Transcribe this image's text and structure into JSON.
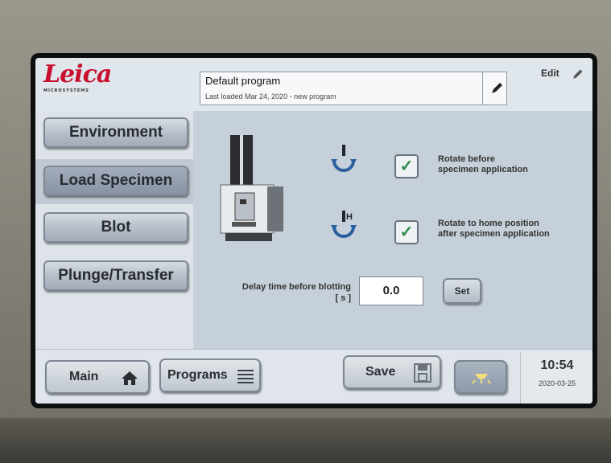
{
  "brand": {
    "name": "Leica",
    "sub": "MICROSYSTEMS"
  },
  "program": {
    "name": "Default program",
    "info": "Last loaded Mar 24, 2020 - new program"
  },
  "header": {
    "edit_label": "Edit"
  },
  "nav": {
    "items": [
      {
        "label": "Environment"
      },
      {
        "label": "Load Specimen"
      },
      {
        "label": "Blot"
      },
      {
        "label": "Plunge/Transfer"
      }
    ],
    "active": "Load Specimen"
  },
  "options": [
    {
      "line1": "Rotate before",
      "line2": "specimen application",
      "checked": true,
      "icon": "rotate-arrow-icon"
    },
    {
      "line1": "Rotate to home position",
      "line2": "after specimen application",
      "checked": true,
      "icon": "rotate-home-icon",
      "icon_letter": "H"
    }
  ],
  "delay": {
    "label": "Delay time before blotting",
    "unit": "[ s ]",
    "value": "0.0",
    "set_label": "Set"
  },
  "bottom": {
    "main_label": "Main",
    "programs_label": "Programs",
    "save_label": "Save"
  },
  "status": {
    "time": "10:54",
    "date": "2020-03-25"
  },
  "colors": {
    "brand_red": "#c8102e",
    "check_green": "#2e8a4c",
    "icon_blue": "#2a5f9e"
  }
}
